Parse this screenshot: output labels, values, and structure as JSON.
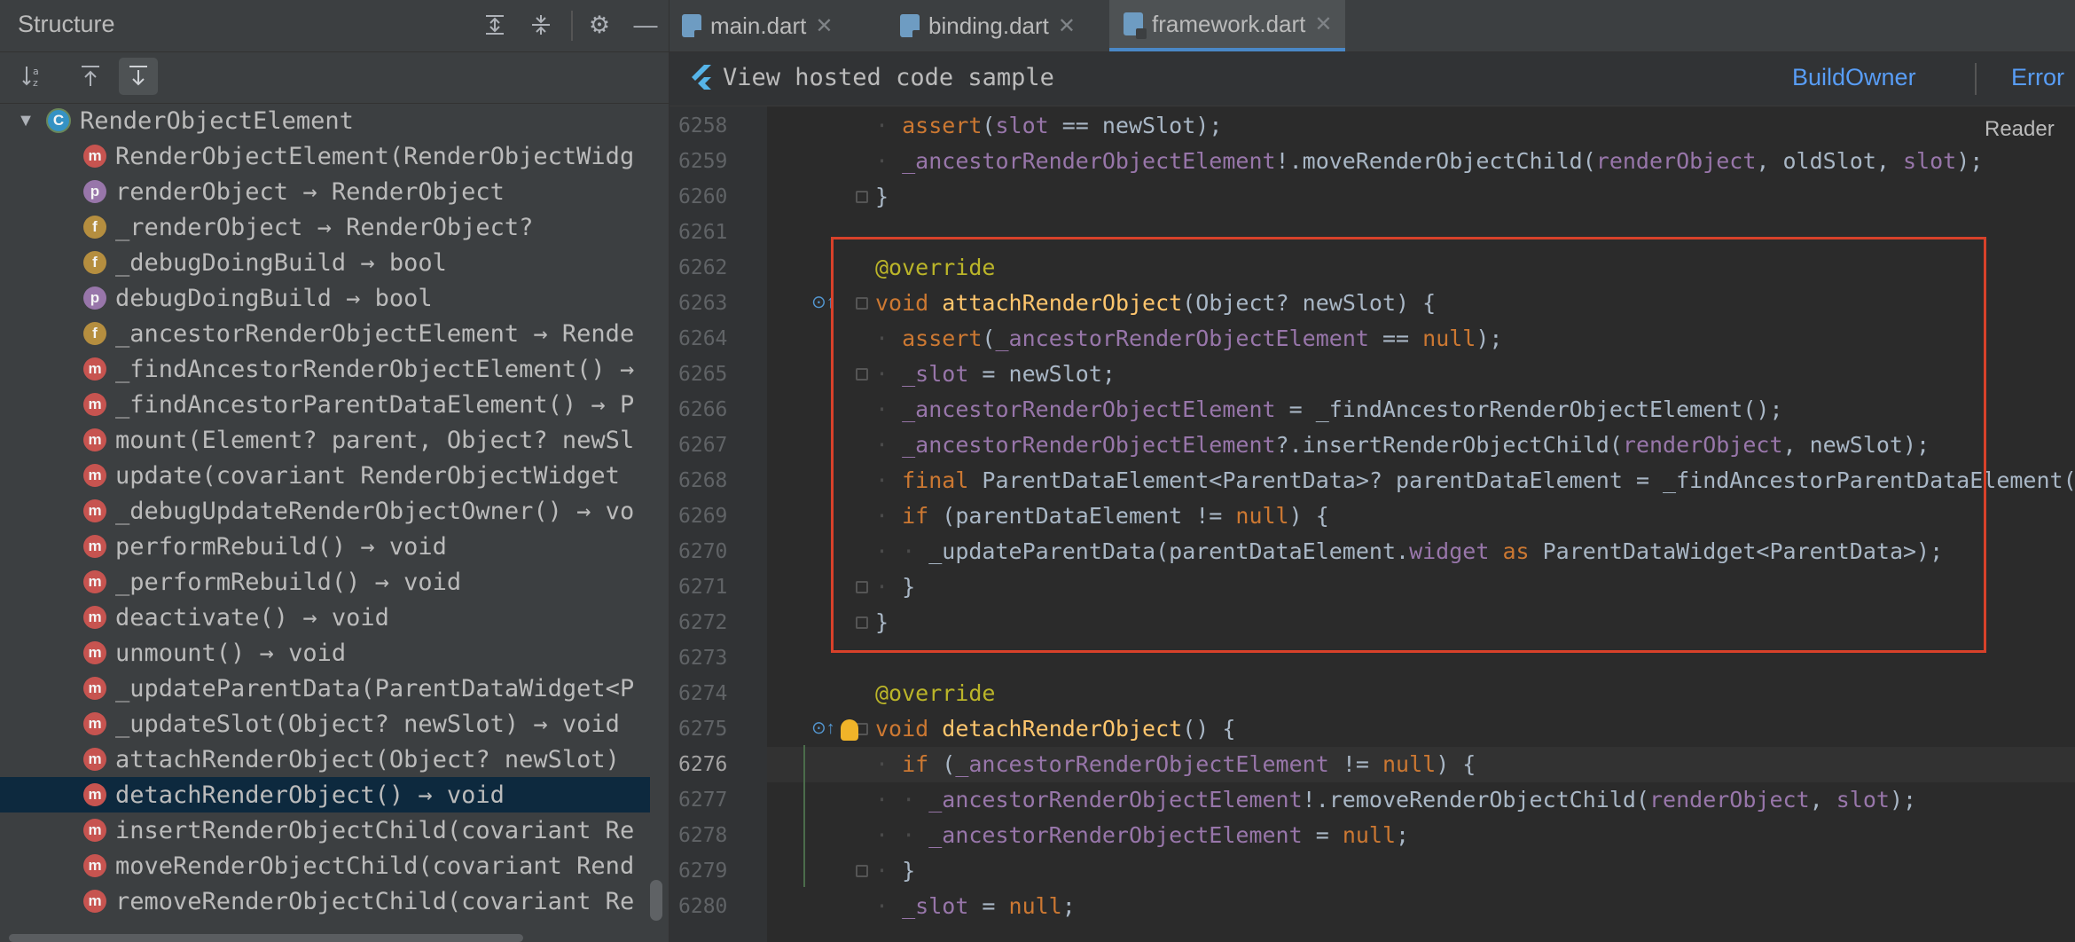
{
  "structure": {
    "title": "Structure",
    "header_icons": [
      "expand-all-icon",
      "collapse-all-icon",
      "gear-icon",
      "minimize-icon"
    ],
    "toolbar_icons": [
      "sort-alpha-icon",
      "navigate-up-icon",
      "navigate-down-icon"
    ],
    "root": {
      "badge": "C",
      "label": "RenderObjectElement"
    },
    "items": [
      {
        "badge": "m",
        "label": "RenderObjectElement(RenderObjectWidg"
      },
      {
        "badge": "p",
        "label": "renderObject → RenderObject"
      },
      {
        "badge": "f",
        "label": "_renderObject → RenderObject?"
      },
      {
        "badge": "f",
        "label": "_debugDoingBuild → bool"
      },
      {
        "badge": "p",
        "label": "debugDoingBuild → bool"
      },
      {
        "badge": "f",
        "label": "_ancestorRenderObjectElement → Rende"
      },
      {
        "badge": "m",
        "label": "_findAncestorRenderObjectElement() →"
      },
      {
        "badge": "m",
        "label": "_findAncestorParentDataElement() → P"
      },
      {
        "badge": "m",
        "label": "mount(Element? parent, Object? newSl"
      },
      {
        "badge": "m",
        "label": "update(covariant RenderObjectWidget"
      },
      {
        "badge": "m",
        "label": "_debugUpdateRenderObjectOwner() → vo"
      },
      {
        "badge": "m",
        "label": "performRebuild() → void"
      },
      {
        "badge": "m",
        "label": "_performRebuild() → void"
      },
      {
        "badge": "m",
        "label": "deactivate() → void"
      },
      {
        "badge": "m",
        "label": "unmount() → void"
      },
      {
        "badge": "m",
        "label": "_updateParentData(ParentDataWidget<P"
      },
      {
        "badge": "m",
        "label": "_updateSlot(Object? newSlot) → void"
      },
      {
        "badge": "m",
        "label": "attachRenderObject(Object? newSlot)"
      },
      {
        "badge": "m",
        "label": "detachRenderObject() → void",
        "selected": true
      },
      {
        "badge": "m",
        "label": "insertRenderObjectChild(covariant Re"
      },
      {
        "badge": "m",
        "label": "moveRenderObjectChild(covariant Rend"
      },
      {
        "badge": "m",
        "label": "removeRenderObjectChild(covariant Re"
      }
    ]
  },
  "editor": {
    "tabs": [
      {
        "label": "main.dart",
        "active": false
      },
      {
        "label": "binding.dart",
        "active": false
      },
      {
        "label": "framework.dart",
        "active": true
      }
    ],
    "banner": {
      "link": "View hosted code sample",
      "breadcrumb": "BuildOwner",
      "breadcrumb2": "Error"
    },
    "reader_mode": "Reader",
    "current_line": "6276",
    "lines": [
      {
        "n": "6258",
        "t": "    assert(slot == newSlot);"
      },
      {
        "n": "6259",
        "t": "    _ancestorRenderObjectElement!.moveRenderObjectChild(renderObject, oldSlot, slot);"
      },
      {
        "n": "6260",
        "t": "  }"
      },
      {
        "n": "6261",
        "t": ""
      },
      {
        "n": "6262",
        "t": "  @override"
      },
      {
        "n": "6263",
        "t": "  void attachRenderObject(Object? newSlot) {"
      },
      {
        "n": "6264",
        "t": "    assert(_ancestorRenderObjectElement == null);"
      },
      {
        "n": "6265",
        "t": "    _slot = newSlot;"
      },
      {
        "n": "6266",
        "t": "    _ancestorRenderObjectElement = _findAncestorRenderObjectElement();"
      },
      {
        "n": "6267",
        "t": "    _ancestorRenderObjectElement?.insertRenderObjectChild(renderObject, newSlot);"
      },
      {
        "n": "6268",
        "t": "    final ParentDataElement<ParentData>? parentDataElement = _findAncestorParentDataElement();"
      },
      {
        "n": "6269",
        "t": "    if (parentDataElement != null) {"
      },
      {
        "n": "6270",
        "t": "      _updateParentData(parentDataElement.widget as ParentDataWidget<ParentData>);"
      },
      {
        "n": "6271",
        "t": "    }"
      },
      {
        "n": "6272",
        "t": "  }"
      },
      {
        "n": "6273",
        "t": ""
      },
      {
        "n": "6274",
        "t": "  @override"
      },
      {
        "n": "6275",
        "t": "  void detachRenderObject() {"
      },
      {
        "n": "6276",
        "t": "    if (_ancestorRenderObjectElement != null) {"
      },
      {
        "n": "6277",
        "t": "      _ancestorRenderObjectElement!.removeRenderObjectChild(renderObject, slot);"
      },
      {
        "n": "6278",
        "t": "      _ancestorRenderObjectElement = null;"
      },
      {
        "n": "6279",
        "t": "    }"
      },
      {
        "n": "6280",
        "t": "    _slot = null;"
      }
    ]
  },
  "colors": {
    "highlight_border": "#d8412a",
    "keyword": "#cc7832",
    "function": "#ffc66d",
    "field": "#9876aa",
    "annotation": "#bbb529",
    "link": "#589df6"
  }
}
